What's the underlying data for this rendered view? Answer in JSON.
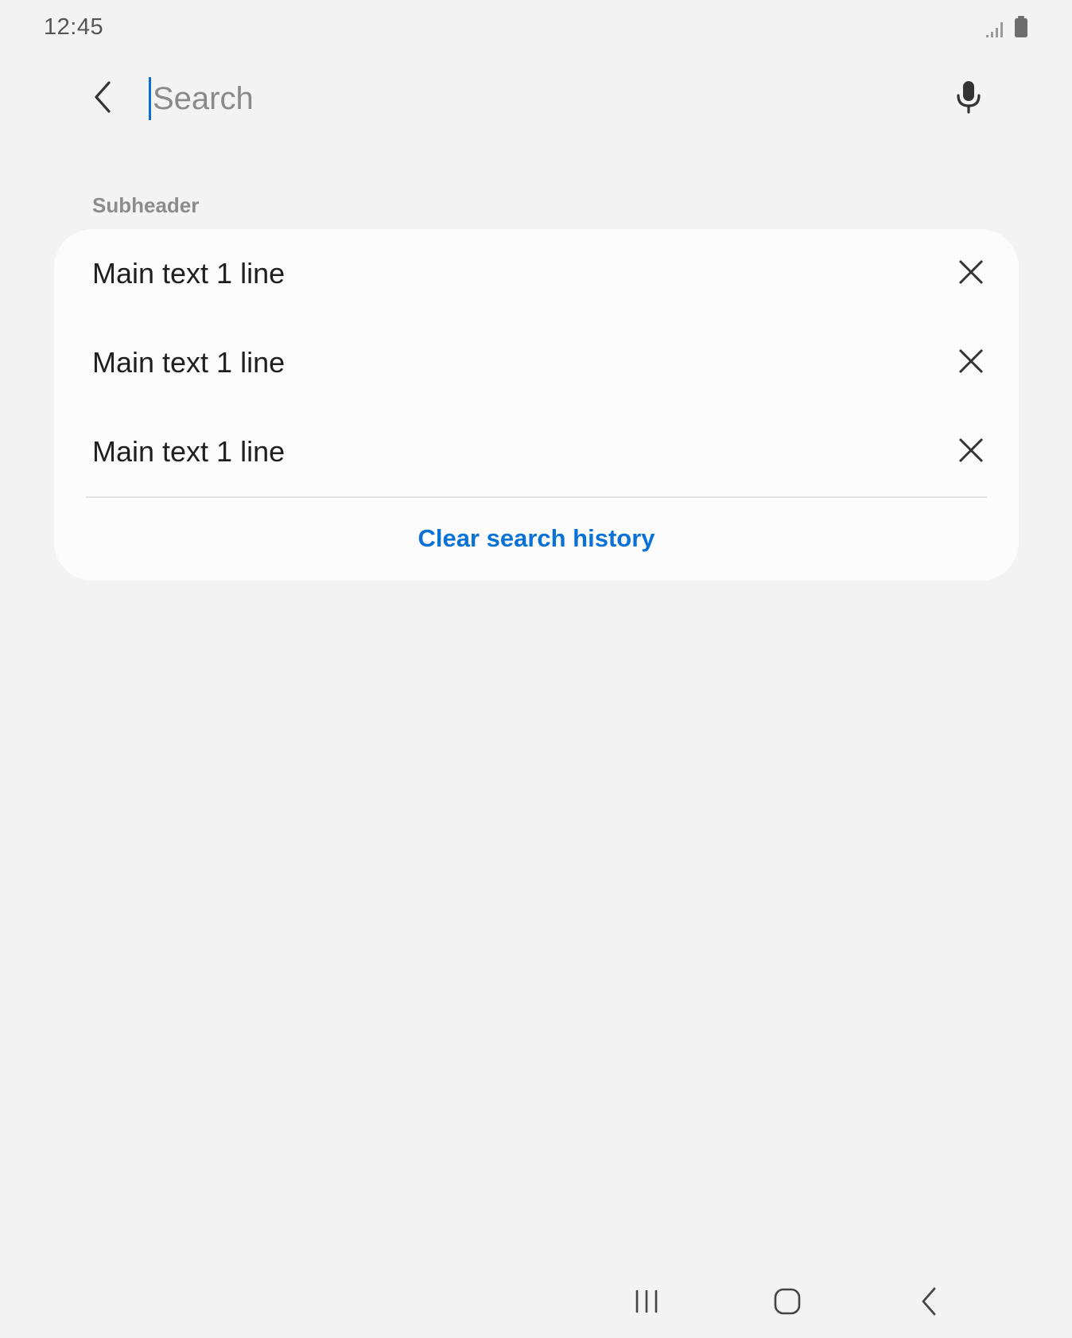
{
  "status_bar": {
    "time": "12:45",
    "icons": [
      "signal-icon",
      "battery-icon"
    ]
  },
  "search": {
    "placeholder": "Search",
    "value": "",
    "back_icon": "back-arrow-icon",
    "mic_icon": "microphone-icon"
  },
  "history": {
    "subheader": "Subheader",
    "items": [
      {
        "label": "Main text 1 line",
        "action_icon": "close-icon"
      },
      {
        "label": "Main text 1 line",
        "action_icon": "close-icon"
      },
      {
        "label": "Main text 1 line",
        "action_icon": "close-icon"
      }
    ],
    "clear_label": "Clear search history"
  },
  "navigation": {
    "buttons": [
      "recent-apps-icon",
      "home-icon",
      "back-icon"
    ]
  },
  "colors": {
    "background": "#f3f3f3",
    "card": "#fcfcfc",
    "accent": "#0a72d6",
    "caret": "#0a6fd6"
  }
}
